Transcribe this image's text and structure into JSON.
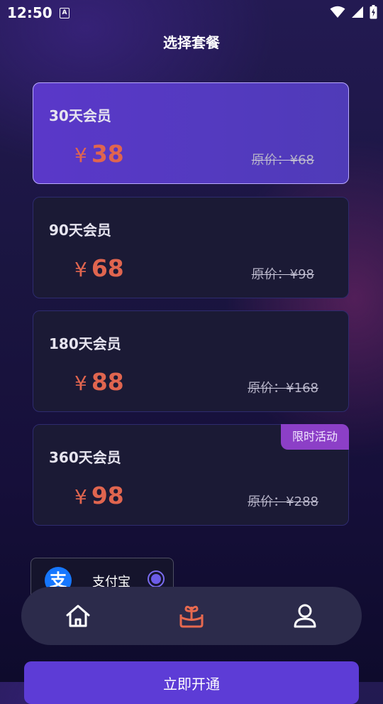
{
  "status_bar": {
    "time": "12:50",
    "notification_icon": "A"
  },
  "page": {
    "title": "选择套餐"
  },
  "plans": [
    {
      "name": "30天会员",
      "currency": "¥",
      "price": "38",
      "original": "原价：¥68",
      "selected": true
    },
    {
      "name": "90天会员",
      "currency": "¥",
      "price": "68",
      "original": "原价：¥98",
      "selected": false
    },
    {
      "name": "180天会员",
      "currency": "¥",
      "price": "88",
      "original": "原价：¥168",
      "selected": false
    },
    {
      "name": "360天会员",
      "currency": "¥",
      "price": "98",
      "original": "原价：¥288",
      "selected": false,
      "badge": "限时活动"
    }
  ],
  "payment": {
    "method_label": "支付宝",
    "icon_glyph": "支",
    "selected": true
  },
  "nav": {
    "items": [
      "home",
      "gift",
      "profile"
    ],
    "active": "gift",
    "active_color": "#e7694f"
  },
  "cta": {
    "label": "立即开通"
  },
  "colors": {
    "accent": "#5d3cd6",
    "price": "#e0654f",
    "badge": "#8c3fc7"
  }
}
